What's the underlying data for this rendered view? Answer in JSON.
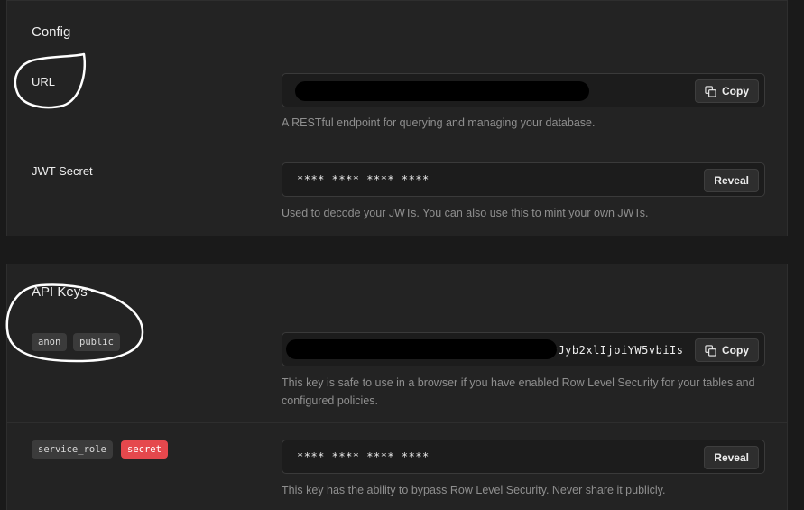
{
  "config": {
    "title": "Config",
    "url": {
      "label": "URL",
      "copy_label": "Copy",
      "help": "A RESTful endpoint for querying and managing your database."
    },
    "jwt": {
      "label": "JWT Secret",
      "value": "**** **** **** ****",
      "reveal_label": "Reveal",
      "help": "Used to decode your JWTs. You can also use this to mint your own JWTs."
    }
  },
  "api_keys": {
    "title": "API Keys",
    "anon": {
      "badges": [
        "anon",
        "public"
      ],
      "visible_value": "eyJyb2xlIjoiYW5vbiIs",
      "copy_label": "Copy",
      "help": "This key is safe to use in a browser if you have enabled Row Level Security for your tables and configured policies."
    },
    "service_role": {
      "badges": [
        "service_role",
        "secret"
      ],
      "value": "**** **** **** ****",
      "reveal_label": "Reveal",
      "help": "This key has the ability to bypass Row Level Security. Never share it publicly."
    }
  },
  "colors": {
    "background": "#1a1a1a",
    "card": "#232323",
    "secret_badge": "#e5484d",
    "annotation": "#ffffff"
  },
  "icons": [
    "copy-icon"
  ]
}
